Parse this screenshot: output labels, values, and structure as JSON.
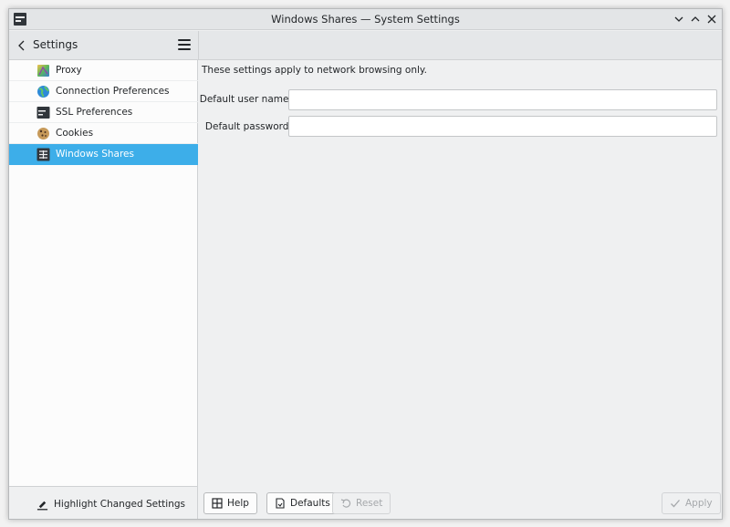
{
  "window": {
    "title": "Windows Shares — System Settings"
  },
  "sidebar": {
    "title": "Settings",
    "items": [
      {
        "label": "Proxy",
        "icon": "proxy-icon"
      },
      {
        "label": "Connection Preferences",
        "icon": "globe-icon"
      },
      {
        "label": "SSL Preferences",
        "icon": "terminal-icon"
      },
      {
        "label": "Cookies",
        "icon": "cookie-icon"
      },
      {
        "label": "Windows Shares",
        "icon": "network-share-icon",
        "selected": true
      }
    ],
    "highlight_label": "Highlight Changed Settings"
  },
  "main": {
    "notice": "These settings apply to network browsing only.",
    "username_label": "Default user name:",
    "username_value": "",
    "password_label": "Default password:",
    "password_value": ""
  },
  "buttons": {
    "help": "Help",
    "defaults": "Defaults",
    "reset": "Reset",
    "apply": "Apply"
  },
  "colors": {
    "selection": "#3daee9",
    "window_bg": "#eff0f1",
    "sidebar_bg": "#fcfcfc"
  }
}
